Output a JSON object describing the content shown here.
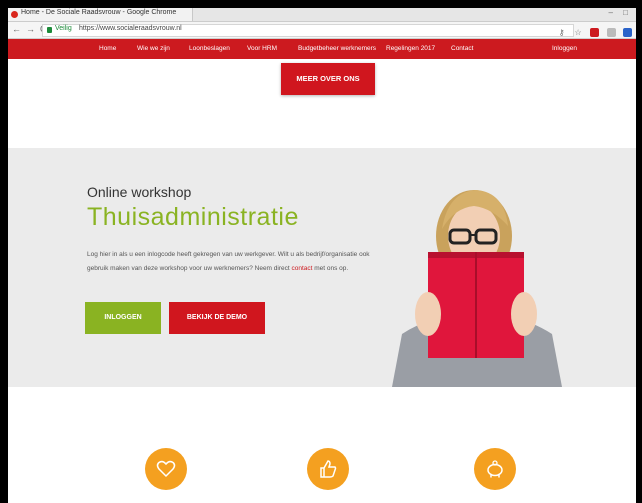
{
  "browser": {
    "tab_title": "Home - De Sociale Raadsvrouw - Google Chrome",
    "secure_label": "Veilig",
    "url": "https://www.socialeraadsvrouw.nl",
    "window_controls": "– □"
  },
  "nav": {
    "items": [
      "Home",
      "Wie we zijn",
      "Loonbeslagen",
      "Voor HRM",
      "Budgetbeheer werknemers",
      "Regelingen 2017",
      "Contact",
      "Inloggen"
    ]
  },
  "cta": {
    "meer_over_ons": "MEER OVER ONS"
  },
  "hero": {
    "subtitle": "Online workshop",
    "title": "Thuisadministratie",
    "text_part1": "Log hier in als u een inlogcode heeft gekregen van uw werkgever. Wilt u als bedrijf/organisatie ook gebruik maken van deze workshop voor uw werknemers? Neem direct ",
    "text_link": "contact",
    "text_part2": " met ons op.",
    "login_button": "INLOGGEN",
    "demo_button": "BEKIJK DE DEMO"
  },
  "features": {
    "icons": [
      "heart-icon",
      "thumbs-up-icon",
      "piggy-bank-icon"
    ]
  },
  "colors": {
    "brand_red": "#cc1a1f",
    "brand_green": "#8ab322",
    "feature_orange": "#f4a020"
  }
}
